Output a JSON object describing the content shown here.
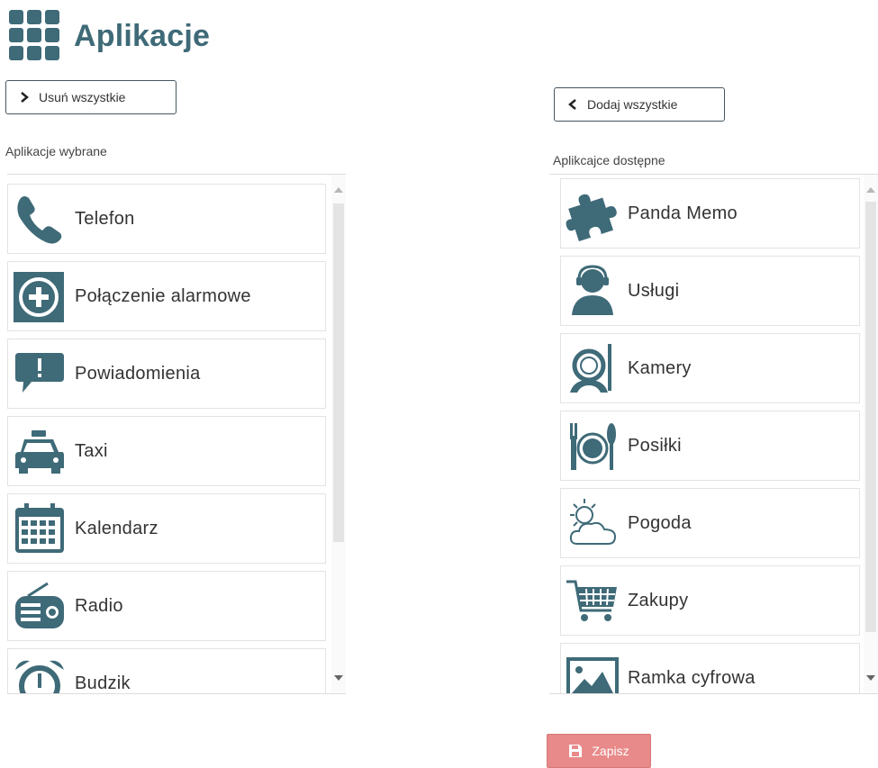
{
  "header": {
    "title": "Aplikacje"
  },
  "selected": {
    "button_label": "Usuń wszystkie",
    "list_label": "Aplikacje wybrane",
    "items": [
      {
        "label": "Telefon",
        "icon": "phone-icon"
      },
      {
        "label": "Połączenie alarmowe",
        "icon": "emergency-plus-icon"
      },
      {
        "label": "Powiadomienia",
        "icon": "notification-bubble-icon"
      },
      {
        "label": "Taxi",
        "icon": "taxi-icon"
      },
      {
        "label": "Kalendarz",
        "icon": "calendar-icon"
      },
      {
        "label": "Radio",
        "icon": "radio-icon"
      },
      {
        "label": "Budzik",
        "icon": "alarm-clock-icon"
      }
    ]
  },
  "available": {
    "button_label": "Dodaj wszystkie",
    "list_label": "Aplikcajce dostępne",
    "items": [
      {
        "label": "Panda Memo",
        "icon": "puzzle-icon"
      },
      {
        "label": "Usługi",
        "icon": "support-agent-icon"
      },
      {
        "label": "Kamery",
        "icon": "camera-lens-icon"
      },
      {
        "label": "Posiłki",
        "icon": "meal-plate-icon"
      },
      {
        "label": "Pogoda",
        "icon": "weather-icon"
      },
      {
        "label": "Zakupy",
        "icon": "shopping-cart-icon"
      },
      {
        "label": "Ramka cyfrowa",
        "icon": "photo-frame-icon"
      }
    ]
  },
  "save": {
    "label": "Zapisz"
  },
  "colors": {
    "icon": "#3f6a78",
    "save_bg": "#e88a8a",
    "border": "#44555f"
  }
}
